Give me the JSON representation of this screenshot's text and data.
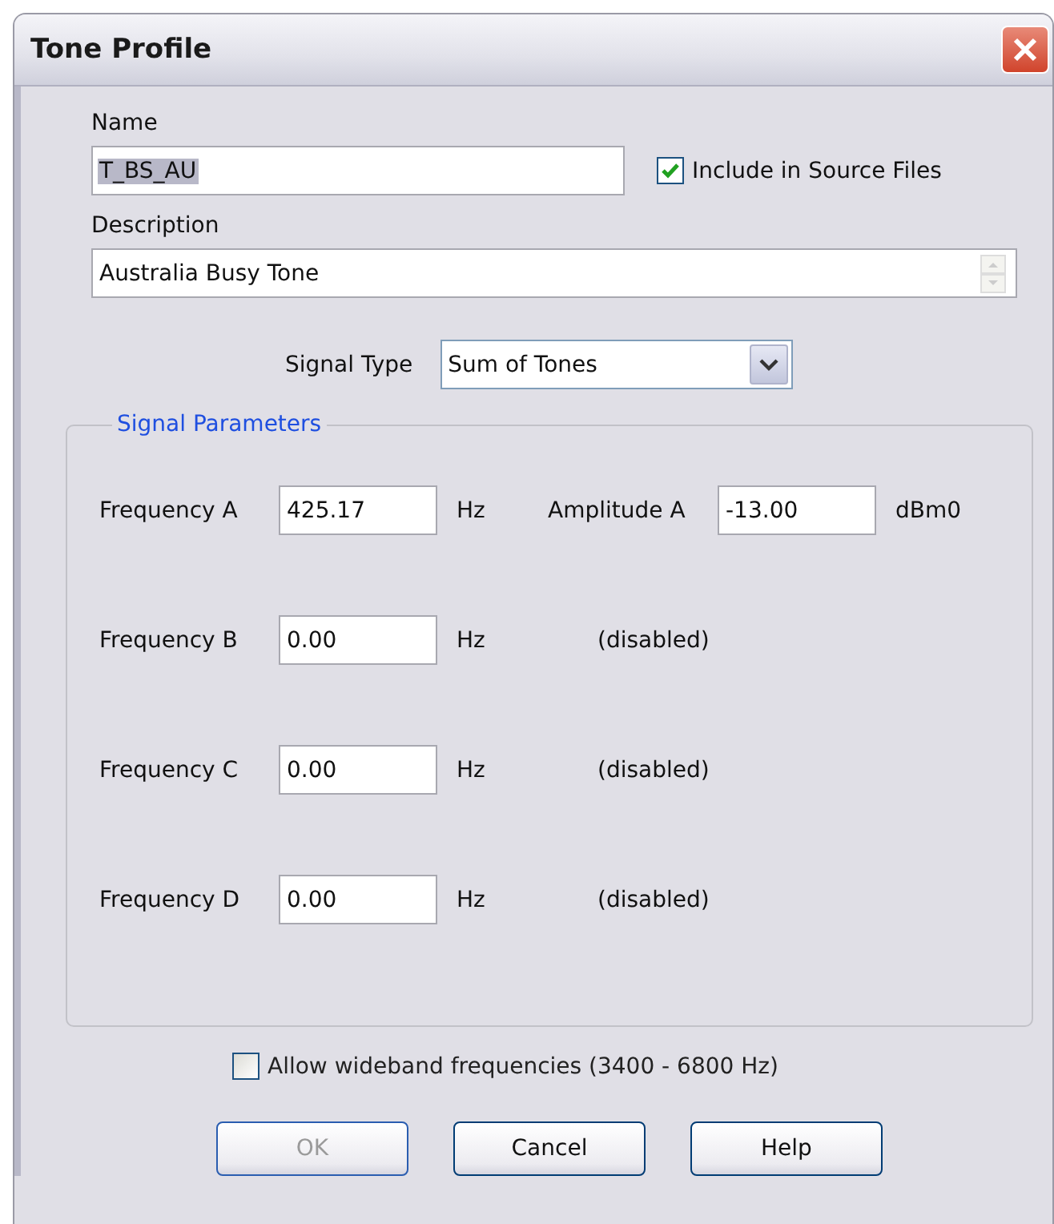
{
  "window": {
    "title": "Tone Profile"
  },
  "name": {
    "label": "Name",
    "value": "T_BS_AU",
    "text_highlighted": true
  },
  "include_in_source": {
    "label": "Include in Source Files",
    "checked": true
  },
  "description": {
    "label": "Description",
    "value": "Australia Busy Tone"
  },
  "signal_type": {
    "label": "Signal Type",
    "value": "Sum of Tones"
  },
  "signal_parameters": {
    "title": "Signal Parameters",
    "rows": [
      {
        "kind": "amplitude",
        "label": "Frequency A",
        "value": "425.17",
        "unit": "Hz",
        "amplitude_label": "Amplitude A",
        "amplitude_value": "-13.00",
        "amplitude_unit": "dBm0"
      },
      {
        "kind": "disabled",
        "label": "Frequency B",
        "value": "0.00",
        "unit": "Hz",
        "status": "(disabled)"
      },
      {
        "kind": "disabled",
        "label": "Frequency C",
        "value": "0.00",
        "unit": "Hz",
        "status": "(disabled)"
      },
      {
        "kind": "disabled",
        "label": "Frequency D",
        "value": "0.00",
        "unit": "Hz",
        "status": "(disabled)"
      }
    ]
  },
  "wideband": {
    "label": "Allow wideband frequencies (3400 - 6800 Hz)",
    "checked": false
  },
  "buttons": [
    {
      "label": "OK",
      "disabled": true
    },
    {
      "label": "Cancel",
      "disabled": false
    },
    {
      "label": "Help",
      "disabled": false
    }
  ]
}
